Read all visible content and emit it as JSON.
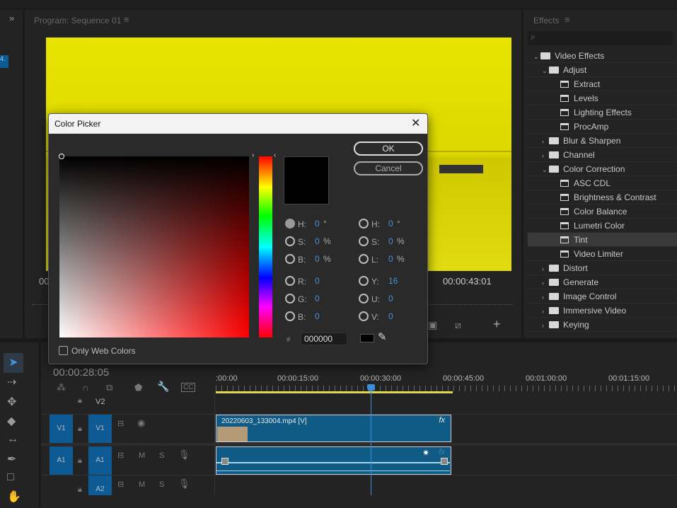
{
  "monitor": {
    "title": "Program: Sequence 01",
    "timecode_left": "00",
    "timecode_right": "00:00:43:01"
  },
  "effects": {
    "title": "Effects",
    "items": [
      {
        "label": "Video Effects",
        "type": "folder",
        "level": 0,
        "open": true
      },
      {
        "label": "Adjust",
        "type": "folder",
        "level": 1,
        "open": true
      },
      {
        "label": "Extract",
        "type": "effect",
        "level": 2
      },
      {
        "label": "Levels",
        "type": "effect",
        "level": 2
      },
      {
        "label": "Lighting Effects",
        "type": "effect",
        "level": 2
      },
      {
        "label": "ProcAmp",
        "type": "effect",
        "level": 2
      },
      {
        "label": "Blur & Sharpen",
        "type": "folder",
        "level": 1,
        "open": false
      },
      {
        "label": "Channel",
        "type": "folder",
        "level": 1,
        "open": false
      },
      {
        "label": "Color Correction",
        "type": "folder",
        "level": 1,
        "open": true
      },
      {
        "label": "ASC CDL",
        "type": "effect",
        "level": 2
      },
      {
        "label": "Brightness & Contrast",
        "type": "effect",
        "level": 2
      },
      {
        "label": "Color Balance",
        "type": "effect",
        "level": 2
      },
      {
        "label": "Lumetri Color",
        "type": "effect",
        "level": 2
      },
      {
        "label": "Tint",
        "type": "effect",
        "level": 2,
        "selected": true
      },
      {
        "label": "Video Limiter",
        "type": "effect",
        "level": 2
      },
      {
        "label": "Distort",
        "type": "folder",
        "level": 1,
        "open": false
      },
      {
        "label": "Generate",
        "type": "folder",
        "level": 1,
        "open": false
      },
      {
        "label": "Image Control",
        "type": "folder",
        "level": 1,
        "open": false
      },
      {
        "label": "Immersive Video",
        "type": "folder",
        "level": 1,
        "open": false
      },
      {
        "label": "Keying",
        "type": "folder",
        "level": 1,
        "open": false
      }
    ]
  },
  "dialog": {
    "title": "Color Picker",
    "ok": "OK",
    "cancel": "Cancel",
    "only_web_colors": "Only Web Colors",
    "hex_label": "#",
    "hex": "000000",
    "left_fields": [
      {
        "label": "H:",
        "value": "0",
        "unit": "°",
        "selected": true
      },
      {
        "label": "S:",
        "value": "0",
        "unit": "%"
      },
      {
        "label": "B:",
        "value": "0",
        "unit": "%"
      },
      {
        "label": "R:",
        "value": "0",
        "unit": ""
      },
      {
        "label": "G:",
        "value": "0",
        "unit": ""
      },
      {
        "label": "B:",
        "value": "0",
        "unit": ""
      }
    ],
    "right_fields": [
      {
        "label": "H:",
        "value": "0",
        "unit": "°"
      },
      {
        "label": "S:",
        "value": "0",
        "unit": "%"
      },
      {
        "label": "L:",
        "value": "0",
        "unit": "%"
      },
      {
        "label": "Y:",
        "value": "16",
        "unit": ""
      },
      {
        "label": "U:",
        "value": "0",
        "unit": ""
      },
      {
        "label": "V:",
        "value": "0",
        "unit": ""
      }
    ],
    "current_color": "#000000"
  },
  "timeline": {
    "timecode": "00:00:28:05",
    "ruler": [
      ":00:00",
      "00:00:15:00",
      "00:00:30:00",
      "00:00:45:00",
      "00:01:00:00",
      "00:01:15:00"
    ],
    "tracks": {
      "v2": "V2",
      "v1": "V1",
      "a1": "A1",
      "a2": "A2"
    },
    "mute": "M",
    "solo": "S",
    "clip_name": "20220603_133004.mp4 [V]",
    "fx": "fx"
  },
  "colors": {
    "accent": "#0e5a94",
    "playhead": "#3b8de0",
    "clip": "#0f5b85"
  }
}
